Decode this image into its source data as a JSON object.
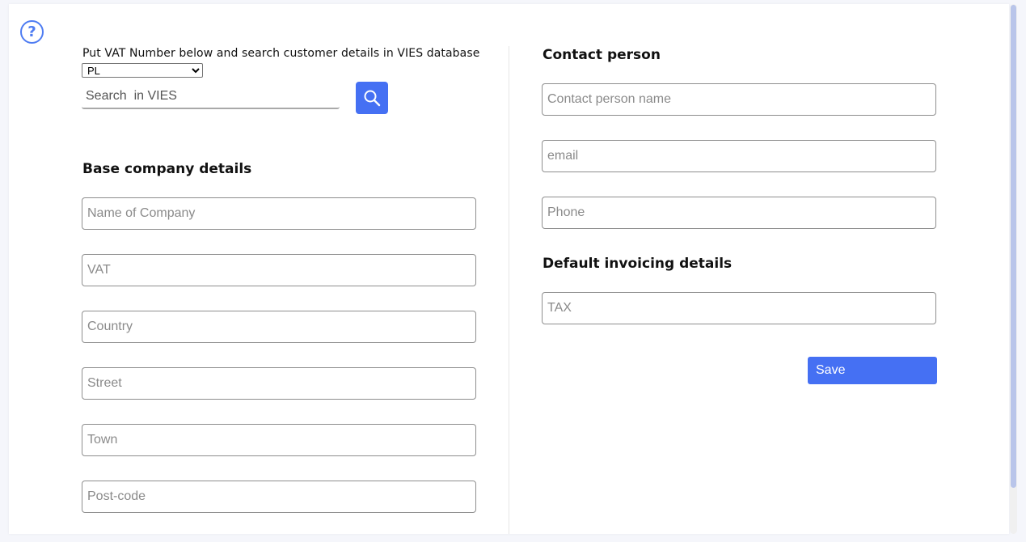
{
  "help": {
    "icon": "question-circle-icon",
    "glyph": "?"
  },
  "vies": {
    "label": "Put VAT Number below and search customer details in VIES database",
    "country_selected": "PL",
    "search_placeholder": "Search  in VIES",
    "search_icon": "search-icon"
  },
  "base_company": {
    "title": "Base company details",
    "fields": {
      "name": "Name of Company",
      "vat": "VAT",
      "country": "Country",
      "street": "Street",
      "town": "Town",
      "postcode": "Post-code"
    }
  },
  "contact": {
    "title": "Contact person",
    "fields": {
      "name": "Contact person name",
      "email": "email",
      "phone": "Phone"
    }
  },
  "invoicing": {
    "title": "Default invoicing details",
    "fields": {
      "tax": "TAX"
    }
  },
  "save_label": "Save",
  "colors": {
    "accent": "#4570f3",
    "help": "#4e7cf2"
  }
}
